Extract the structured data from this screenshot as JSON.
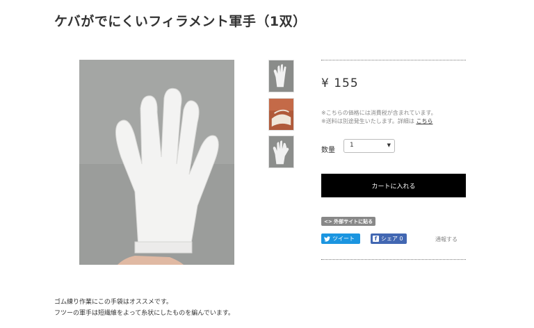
{
  "product": {
    "title": "ケバがでにくいフィラメント軍手（1双）",
    "price": "¥ 155",
    "notes": {
      "line1": "※こちらの価格には消費税が含まれています。",
      "line2_prefix": "※送料は別途発生いたします。詳細は",
      "line2_link": "こちら"
    },
    "quantity": {
      "label": "数量",
      "selected": "1"
    },
    "cart_button_label": "カートに入れる"
  },
  "social": {
    "embed_label": "<> 外部サイトに貼る",
    "tweet_label": "ツイート",
    "share_label": "シェア 0",
    "report_label": "通報する"
  },
  "description": {
    "line1": "ゴム練り作業にこの手袋はオススメです。",
    "line2": "フツーの軍手は短繊維をよって糸状にしたものを編んでいます。"
  },
  "icons": {
    "tweet": "twitter-bird-icon",
    "share": "facebook-f-icon",
    "select": "caret-down-icon"
  },
  "colors": {
    "cart_button": "#000000",
    "tweet": "#1b95e0",
    "share": "#4267b2",
    "embed": "#888888"
  }
}
